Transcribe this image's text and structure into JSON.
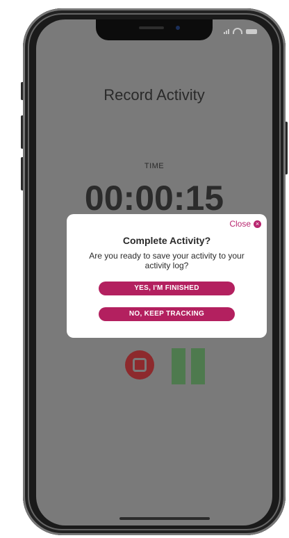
{
  "screen": {
    "title": "Record Activity",
    "time_label": "TIME",
    "timer_value": "00:00:15"
  },
  "modal": {
    "close_label": "Close",
    "title": "Complete Activity?",
    "message": "Are you ready to save your activity to your activity log?",
    "confirm_button": "YES, I'M FINISHED",
    "cancel_button": "NO, KEEP TRACKING"
  },
  "controls": {
    "stop_icon": "stop-icon",
    "pause_icon": "pause-icon"
  },
  "colors": {
    "accent": "#b3205f",
    "stop": "#8d2a2d",
    "pause": "#4e7a4e",
    "overlay_screen": "#7a7a7a"
  }
}
